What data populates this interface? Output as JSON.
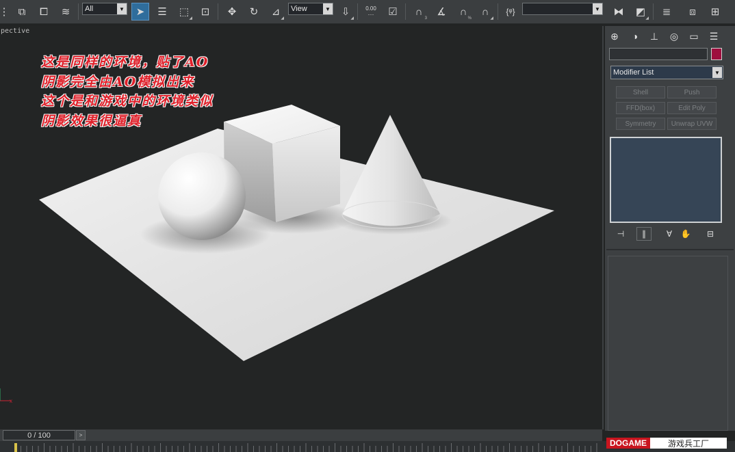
{
  "toolbar": {
    "selection_filter": "All",
    "reference_coord": "View",
    "spinner_value": "0.00",
    "named_selection": "",
    "icons": [
      "undo-arrow-icon",
      "link-icon",
      "unlink-icon",
      "bind-space-warp-icon",
      "select-object-icon",
      "select-by-name-icon",
      "rectangular-selection-icon",
      "window-crossing-icon",
      "move-icon",
      "rotate-icon",
      "scale-icon",
      "use-pivot-icon",
      "keyboard-shortcut-icon",
      "snap-toggle-icon",
      "angle-snap-icon",
      "percent-snap-icon",
      "spinner-snap-icon",
      "edit-named-sets-icon",
      "mirror-icon",
      "align-icon",
      "layer-manager-icon",
      "curve-editor-icon",
      "schematic-view-icon"
    ]
  },
  "viewport": {
    "label": "pective",
    "annotation_lines": [
      "这是同样的环境，贴了AO",
      "阴影完全由AO模拟出来",
      "这个是和游戏中的环境类似",
      "阴影效果很逼真"
    ],
    "axis_x_label": "x",
    "background_color": "#232525",
    "annotation_color": "#e0202a"
  },
  "command_panel": {
    "tabs": [
      "create-tab-icon",
      "modify-tab-icon",
      "hierarchy-tab-icon",
      "motion-tab-icon",
      "display-tab-icon",
      "utilities-tab-icon"
    ],
    "object_name": "",
    "object_color": "#9e0e3e",
    "modifier_list": "Modifier List",
    "modifier_buttons": [
      "Shell",
      "Push",
      "FFD(box)",
      "Edit Poly",
      "Symmetry",
      "Unwrap UVW"
    ],
    "stack_buttons": [
      "pin-stack-icon",
      "show-end-result-icon",
      "make-unique-icon",
      "remove-modifier-icon",
      "configure-modifier-sets-icon"
    ]
  },
  "timeline": {
    "frame_display": "0 / 100",
    "next_label": ">"
  },
  "watermark": {
    "brand": "DOGAME",
    "brand_cn": "游戏兵工厂"
  }
}
